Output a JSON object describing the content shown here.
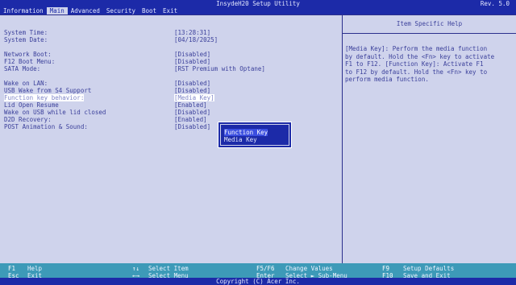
{
  "header": {
    "title": "InsydeH20 Setup Utility",
    "revision": "Rev. 5.0",
    "menu": [
      "Information",
      "Main",
      "Advanced",
      "Security",
      "Boot",
      "Exit"
    ],
    "active_menu": "Main"
  },
  "settings": [
    {
      "label": "System Time:",
      "value": "[13:28:31]"
    },
    {
      "label": "System Date:",
      "value": "[04/18/2025]"
    },
    {
      "label": "Network Boot:",
      "value": "[Disabled]"
    },
    {
      "label": "F12 Boot Menu:",
      "value": "[Disabled]"
    },
    {
      "label": "SATA Mode:",
      "value": "[RST Premium with Optane]"
    },
    {
      "label": "Wake on LAN:",
      "value": "[Disabled]"
    },
    {
      "label": "USB Wake from S4 Support",
      "value": "[Disabled]"
    },
    {
      "label": "Function key behavior:",
      "value": "[Media Key]"
    },
    {
      "label": "Lid Open Resume",
      "value": "[Enabled]"
    },
    {
      "label": "Wake on USB while lid closed",
      "value": "[Disabled]"
    },
    {
      "label": "D2D Recovery:",
      "value": "[Enabled]"
    },
    {
      "label": "POST Animation & Sound:",
      "value": "[Disabled]"
    }
  ],
  "popup": {
    "options": [
      "Function Key",
      "Media Key"
    ],
    "highlighted": "Function Key"
  },
  "help": {
    "title": "Item Specific Help",
    "lines": [
      "[Media Key]: Perform the media function",
      "by default. Hold the <Fn> key to activate",
      "F1 to F12. [Function Key]: Activate F1",
      "to F12 by default. Hold the <Fn> key to",
      "perform media function."
    ]
  },
  "footer": {
    "keys": [
      {
        "key": "F1",
        "desc": "Help"
      },
      {
        "key": "Esc",
        "desc": "Exit"
      },
      {
        "key": "↑↓",
        "desc": "Select Item"
      },
      {
        "key": "←→",
        "desc": "Select Menu"
      },
      {
        "key": "F5/F6",
        "desc": "Change Values"
      },
      {
        "key": "Enter",
        "desc": "Select ► Sub-Menu"
      },
      {
        "key": "F9",
        "desc": "Setup Defaults"
      },
      {
        "key": "F10",
        "desc": "Save and Exit"
      }
    ],
    "copyright": "Copyright (C) Acer Inc."
  }
}
